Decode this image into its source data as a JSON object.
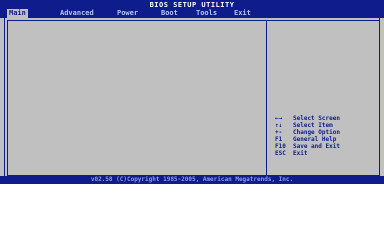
{
  "header": {
    "title": "BIOS SETUP UTILITY",
    "tabs": [
      {
        "label": "Main",
        "active": true
      },
      {
        "label": "Advanced",
        "active": false
      },
      {
        "label": "Power",
        "active": false
      },
      {
        "label": "Boot",
        "active": false
      },
      {
        "label": "Tools",
        "active": false
      },
      {
        "label": "Exit",
        "active": false
      }
    ]
  },
  "help": [
    {
      "key": "←→",
      "desc": "Select Screen"
    },
    {
      "key": "↑↓",
      "desc": "Select Item"
    },
    {
      "key": "+-",
      "desc": "Change Option"
    },
    {
      "key": "F1",
      "desc": "General Help"
    },
    {
      "key": "F10",
      "desc": "Save and Exit"
    },
    {
      "key": "ESC",
      "desc": "Exit"
    }
  ],
  "footer": {
    "text": "v02.58 (C)Copyright 1985-2005, American Megatrends, Inc."
  },
  "colors": {
    "bios_blue": "#0e1c8c",
    "panel_gray": "#c0c0c0"
  }
}
